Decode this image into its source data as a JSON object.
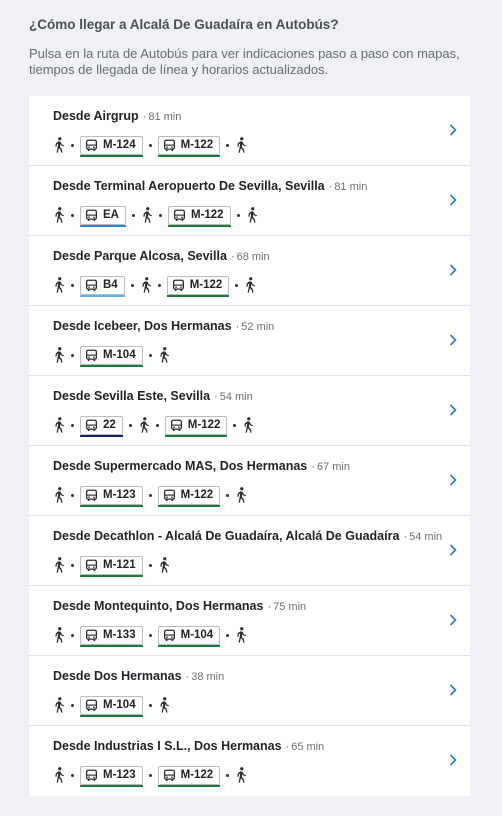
{
  "heading": "¿Cómo llegar a Alcalá De Guadaíra en Autobús?",
  "subtitle": "Pulsa en la ruta de Autobús para ver indicaciones paso a paso con mapas, tiempos de llegada de línea y horarios actualizados.",
  "colors": {
    "green": "#1f7a3a",
    "lightblue": "#5fb3ec",
    "blue": "#2a86d8",
    "navy": "#1a1f6e",
    "chevron": "#2b78d4"
  },
  "routes": [
    {
      "title": "Desde Airgrup",
      "duration": "81 min",
      "steps": [
        {
          "type": "walk"
        },
        {
          "type": "bus",
          "label": "M-124",
          "color": "#1f7a3a"
        },
        {
          "type": "bus",
          "label": "M-122",
          "color": "#1f7a3a"
        },
        {
          "type": "walk"
        }
      ]
    },
    {
      "title": "Desde Terminal Aeropuerto De Sevilla, Sevilla",
      "duration": "81 min",
      "steps": [
        {
          "type": "walk"
        },
        {
          "type": "bus",
          "label": "EA",
          "color": "#2a86d8"
        },
        {
          "type": "walk"
        },
        {
          "type": "bus",
          "label": "M-122",
          "color": "#1f7a3a"
        },
        {
          "type": "walk"
        }
      ]
    },
    {
      "title": "Desde Parque Alcosa, Sevilla",
      "duration": "68 min",
      "steps": [
        {
          "type": "walk"
        },
        {
          "type": "bus",
          "label": "B4",
          "color": "#5fb3ec"
        },
        {
          "type": "walk"
        },
        {
          "type": "bus",
          "label": "M-122",
          "color": "#1f7a3a"
        },
        {
          "type": "walk"
        }
      ]
    },
    {
      "title": "Desde Icebeer, Dos Hermanas",
      "duration": "52 min",
      "steps": [
        {
          "type": "walk"
        },
        {
          "type": "bus",
          "label": "M-104",
          "color": "#1f7a3a"
        },
        {
          "type": "walk"
        }
      ]
    },
    {
      "title": "Desde Sevilla Este, Sevilla",
      "duration": "54 min",
      "steps": [
        {
          "type": "walk"
        },
        {
          "type": "bus",
          "label": "22",
          "color": "#1a1f6e"
        },
        {
          "type": "walk"
        },
        {
          "type": "bus",
          "label": "M-122",
          "color": "#1f7a3a"
        },
        {
          "type": "walk"
        }
      ]
    },
    {
      "title": "Desde Supermercado MAS, Dos Hermanas",
      "duration": "67 min",
      "steps": [
        {
          "type": "walk"
        },
        {
          "type": "bus",
          "label": "M-123",
          "color": "#1f7a3a"
        },
        {
          "type": "bus",
          "label": "M-122",
          "color": "#1f7a3a"
        },
        {
          "type": "walk"
        }
      ]
    },
    {
      "title": "Desde Decathlon - Alcalá De Guadaíra, Alcalá De Guadaíra",
      "duration": "54 min",
      "steps": [
        {
          "type": "walk"
        },
        {
          "type": "bus",
          "label": "M-121",
          "color": "#1f7a3a"
        },
        {
          "type": "walk"
        }
      ]
    },
    {
      "title": "Desde Montequinto, Dos Hermanas",
      "duration": "75 min",
      "steps": [
        {
          "type": "walk"
        },
        {
          "type": "bus",
          "label": "M-133",
          "color": "#1f7a3a"
        },
        {
          "type": "bus",
          "label": "M-104",
          "color": "#1f7a3a"
        },
        {
          "type": "walk"
        }
      ]
    },
    {
      "title": "Desde Dos Hermanas",
      "duration": "38 min",
      "steps": [
        {
          "type": "walk"
        },
        {
          "type": "bus",
          "label": "M-104",
          "color": "#1f7a3a"
        },
        {
          "type": "walk"
        }
      ]
    },
    {
      "title": "Desde Industrias I S.L., Dos Hermanas",
      "duration": "65 min",
      "steps": [
        {
          "type": "walk"
        },
        {
          "type": "bus",
          "label": "M-123",
          "color": "#1f7a3a"
        },
        {
          "type": "bus",
          "label": "M-122",
          "color": "#1f7a3a"
        },
        {
          "type": "walk"
        }
      ]
    }
  ]
}
